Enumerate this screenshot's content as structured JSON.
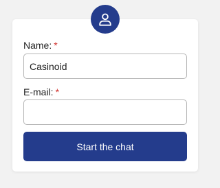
{
  "avatar": {
    "icon": "user-icon",
    "color": "#243c8c"
  },
  "form": {
    "name_label": "Name:",
    "name_required": "*",
    "name_value": "Casinoid",
    "email_label": "E-mail:",
    "email_required": "*",
    "email_value": "",
    "submit_label": "Start the chat"
  },
  "colors": {
    "accent": "#243c8c",
    "required": "#d0312d",
    "background": "#f2f2f2"
  }
}
